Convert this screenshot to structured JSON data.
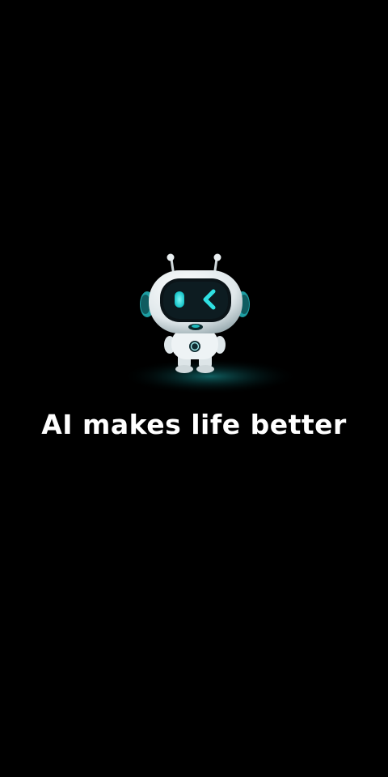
{
  "splash": {
    "tagline": "AI makes life better",
    "mascot": {
      "icon": "robot-mascot-icon",
      "body_color": "#e8eef0",
      "visor_color": "#0b1418",
      "glow_color": "#22d3d6"
    },
    "background_color": "#000000"
  }
}
